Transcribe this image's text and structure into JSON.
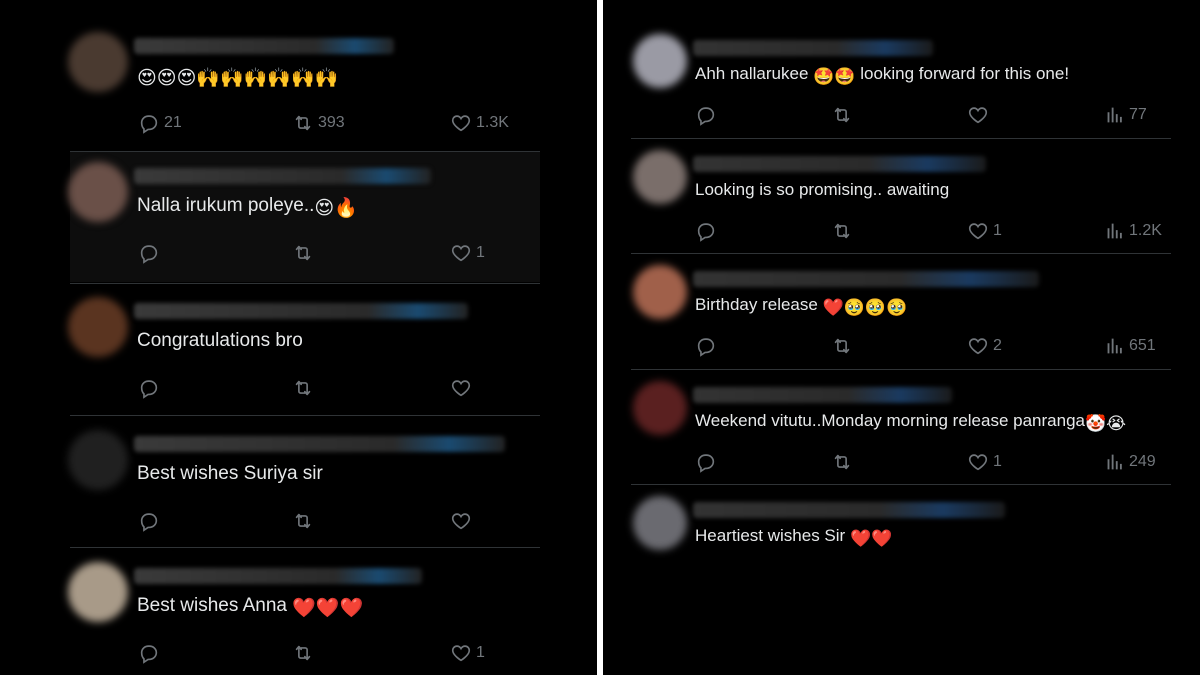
{
  "left_panel": {
    "tweets": [
      {
        "text": "",
        "emojis": "😍😍😍🙌🙌🙌🙌🙌🙌",
        "reply_count": "21",
        "retweet_count": "393",
        "like_count": "1.3K",
        "highlighted": false
      },
      {
        "text": "Nalla irukum poleye..",
        "emojis": "😍🔥",
        "reply_count": "",
        "retweet_count": "",
        "like_count": "1",
        "highlighted": true
      },
      {
        "text": "Congratulations bro",
        "emojis": "",
        "reply_count": "",
        "retweet_count": "",
        "like_count": "",
        "highlighted": false
      },
      {
        "text": "Best wishes Suriya sir",
        "emojis": "",
        "reply_count": "",
        "retweet_count": "",
        "like_count": "",
        "highlighted": false
      },
      {
        "text": "Best wishes Anna ",
        "emojis": "❤️❤️❤️",
        "reply_count": "",
        "retweet_count": "",
        "like_count": "1",
        "highlighted": false
      }
    ]
  },
  "right_panel": {
    "tweets": [
      {
        "text_before": "Ahh nallarukee ",
        "emojis": "🤩🤩",
        "text_after": " looking forward for this one!",
        "like_count": "",
        "view_count": "77"
      },
      {
        "text_before": "Looking is so promising.. awaiting",
        "emojis": "",
        "text_after": "",
        "like_count": "1",
        "view_count": "1.2K"
      },
      {
        "text_before": "Birthday release ",
        "emojis": "❤️🥹🥹🥹",
        "text_after": "",
        "like_count": "2",
        "view_count": "651"
      },
      {
        "text_before": "Weekend vitutu..Monday morning release panranga",
        "emojis": "🤡😭",
        "text_after": "",
        "like_count": "1",
        "view_count": "249"
      },
      {
        "text_before": "Heartiest wishes Sir ",
        "emojis": "❤️❤️",
        "text_after": "",
        "like_count": "",
        "view_count": ""
      }
    ]
  },
  "icons": [
    "reply-icon",
    "retweet-icon",
    "like-icon",
    "views-icon"
  ],
  "colors": {
    "background": "#000000",
    "text": "#e7e9ea",
    "muted": "#71767b",
    "divider": "#2f3336",
    "heart": "#f91880"
  }
}
